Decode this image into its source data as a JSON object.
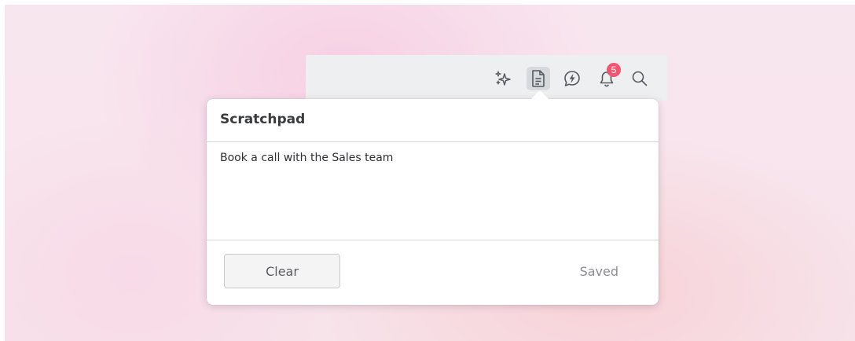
{
  "toolbar": {
    "icons": [
      {
        "name": "sparkles-icon",
        "active": false
      },
      {
        "name": "document-icon",
        "active": true
      },
      {
        "name": "chat-bolt-icon",
        "active": false
      },
      {
        "name": "bell-icon",
        "active": false
      },
      {
        "name": "search-icon",
        "active": false
      }
    ],
    "notification_count": "5"
  },
  "scratchpad": {
    "title": "Scratchpad",
    "note": "Book a call with the Sales team",
    "clear_label": "Clear",
    "status": "Saved"
  },
  "colors": {
    "badge": "#f2556d",
    "toolbar_bg": "#eeeff1",
    "active_icon_bg": "#d6d9de"
  }
}
